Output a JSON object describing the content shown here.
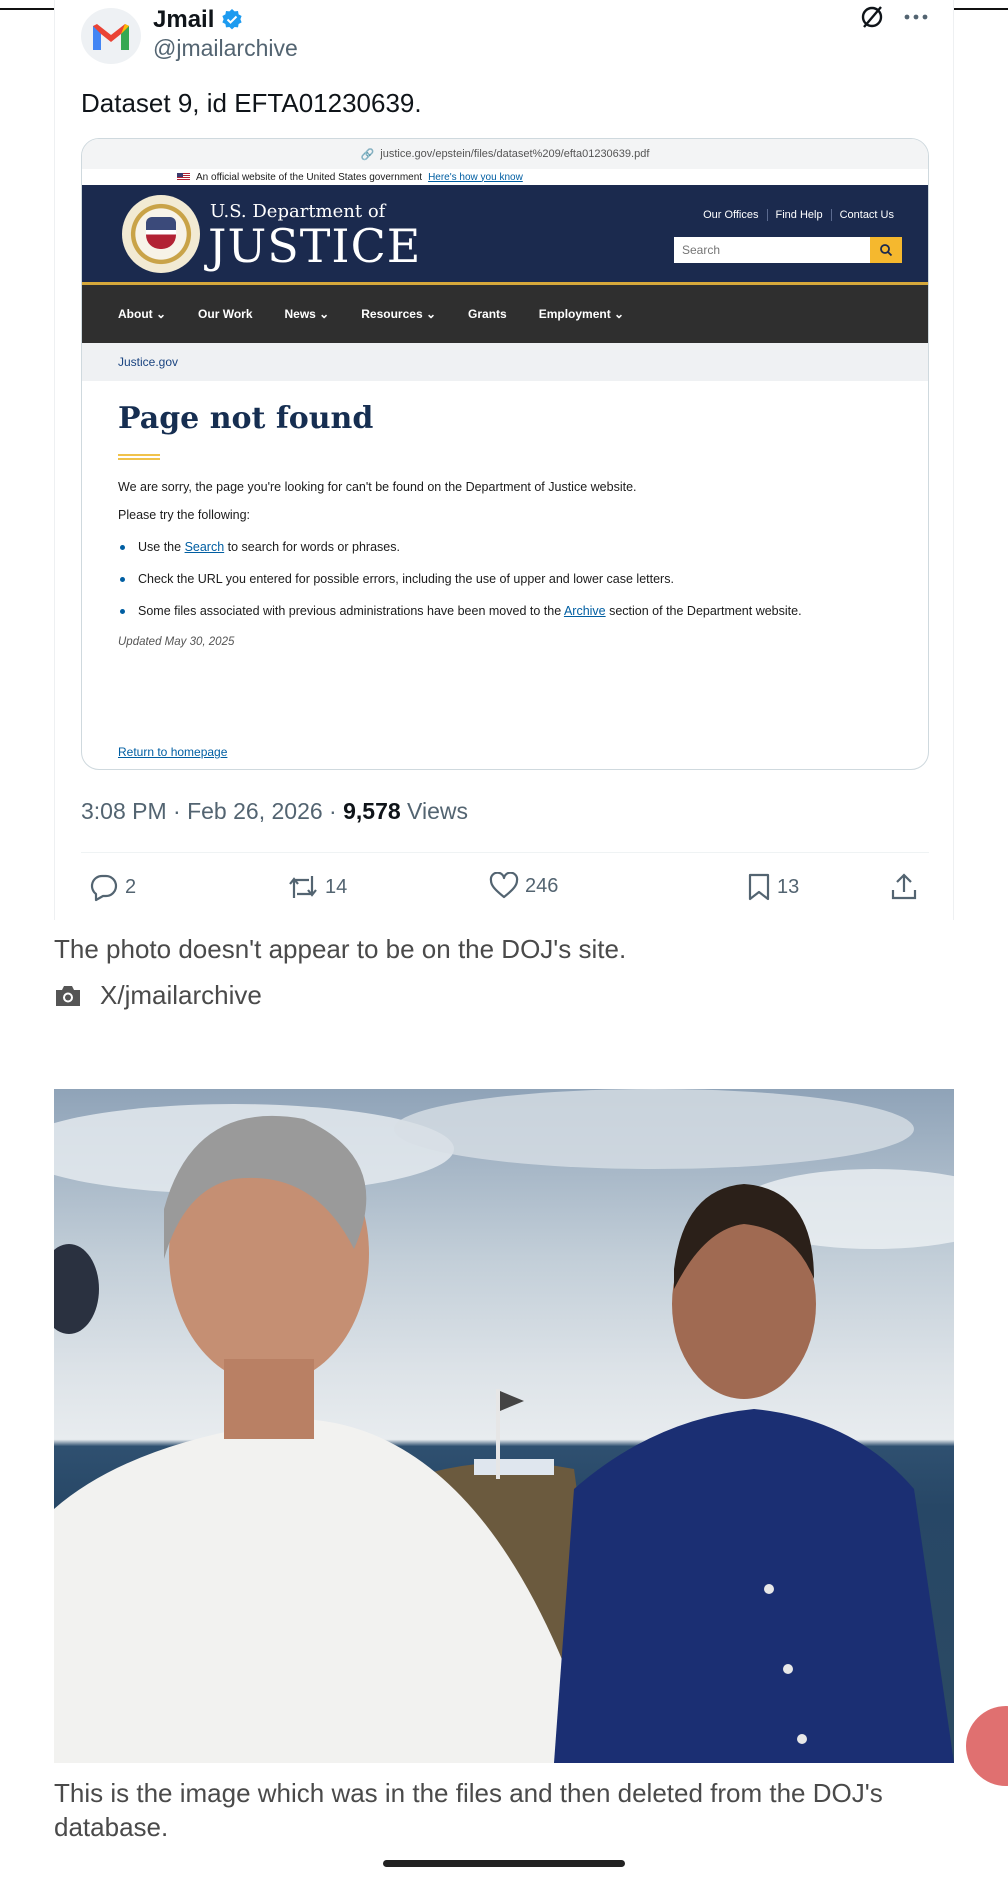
{
  "tweet": {
    "display_name": "Jmail",
    "handle": "@jmailarchive",
    "text": "Dataset 9, id EFTA01230639.",
    "time": "3:08 PM · Feb 26, 2026 · ",
    "views_count": "9,578",
    "views_label": " Views",
    "replies": "2",
    "reposts": "14",
    "likes": "246",
    "bookmarks": "13"
  },
  "screenshot": {
    "url": "justice.gov/epstein/files/dataset%209/efta01230639.pdf",
    "gov_banner": "An official website of the United States government",
    "gov_banner_link": "Here's how you know",
    "dept_sub": "U.S. Department of",
    "dept_main": "JUSTICE",
    "top_links": [
      "Our Offices",
      "Find Help",
      "Contact Us"
    ],
    "search_placeholder": "Search",
    "nav": [
      "About ⌄",
      "Our Work",
      "News ⌄",
      "Resources ⌄",
      "Grants",
      "Employment ⌄"
    ],
    "breadcrumb": "Justice.gov",
    "title": "Page not found",
    "message": "We are sorry, the page you're looking for can't be found on the Department of Justice website.",
    "try_following": "Please try the following:",
    "item1_pre": "Use the ",
    "item1_link": "Search",
    "item1_post": " to search for words or phrases.",
    "item2": "Check the URL you entered for possible errors, including the use of upper and lower case letters.",
    "item3_pre": "Some files associated with previous administrations have been moved to the ",
    "item3_link": "Archive",
    "item3_post": " section of the Department website.",
    "updated": "Updated May 30, 2025",
    "return_link": "Return to homepage"
  },
  "article": {
    "caption1": "The photo doesn't appear to be on the DOJ's site.",
    "credit": "X/jmailarchive",
    "caption2": "This is the image which was in the files and then deleted from the DOJ's database."
  }
}
